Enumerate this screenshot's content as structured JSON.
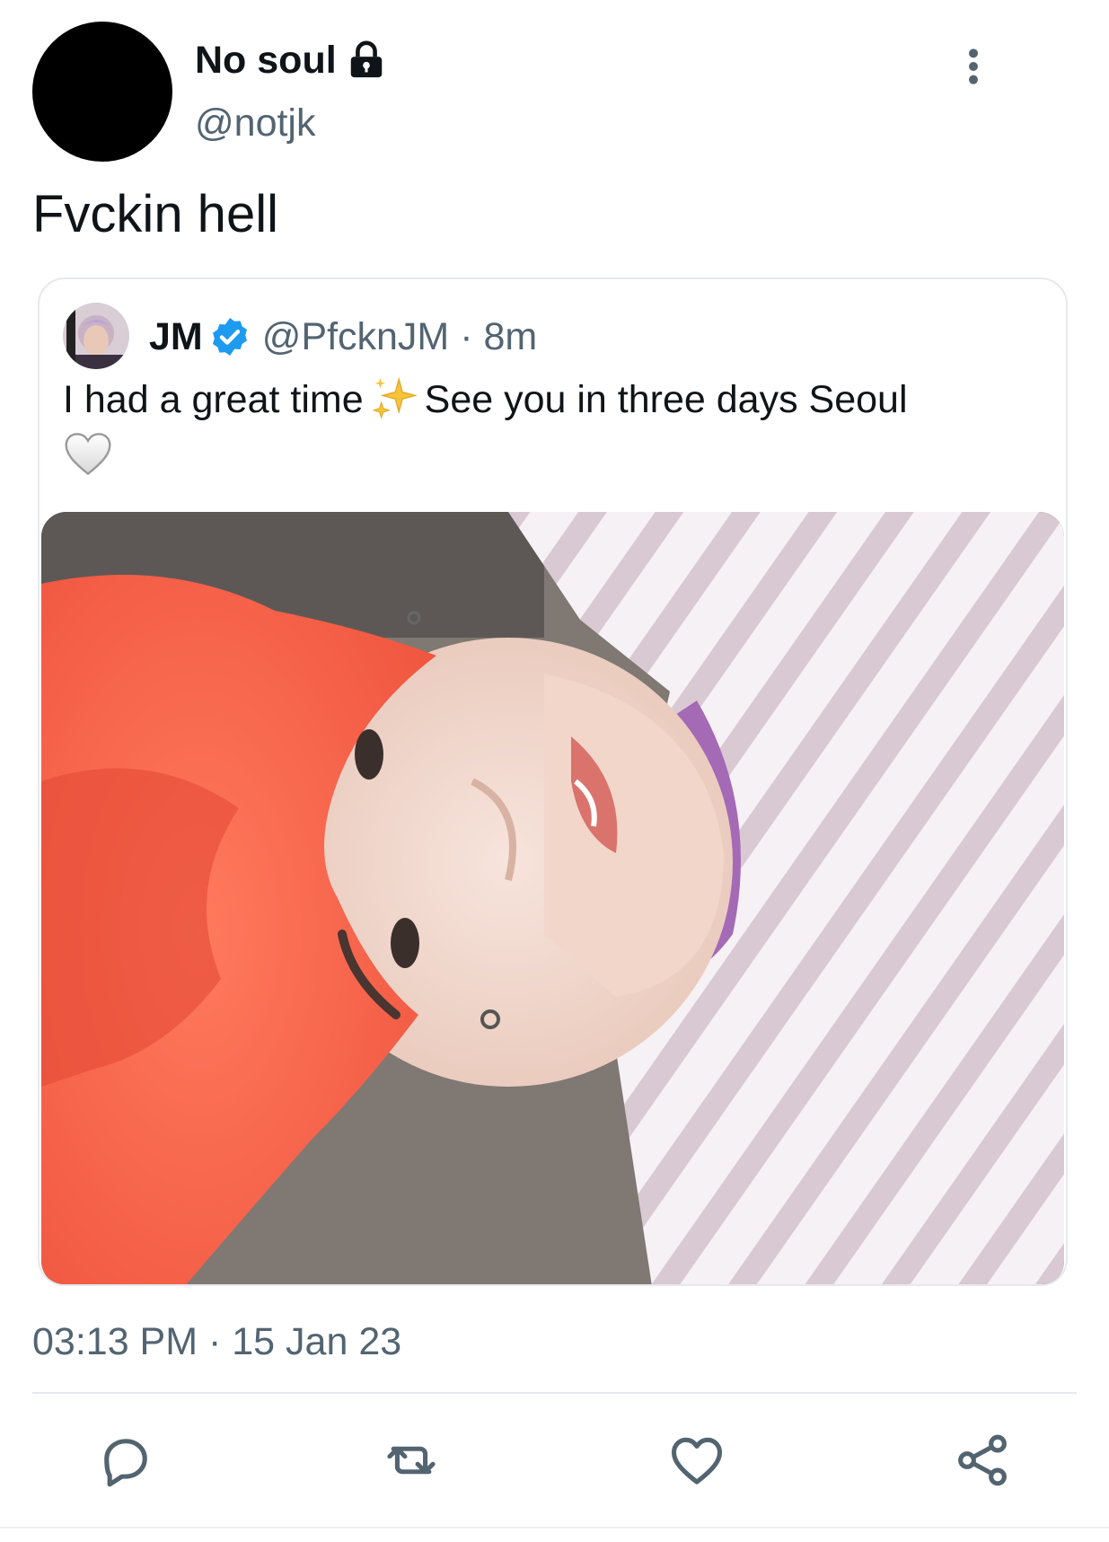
{
  "author": {
    "display_name": "No soul",
    "handle": "@notjk",
    "protected_icon": "lock-icon",
    "avatar_color": "#000000"
  },
  "tweet": {
    "text": "Fvckin hell",
    "timestamp": "03:13 PM · 15 Jan 23"
  },
  "quoted_tweet": {
    "display_name": "JM",
    "verified_icon": "verified-badge-icon",
    "handle_time": "@PfcknJM · 8m",
    "text_part1": "I had a great time",
    "emoji_1": "sparkles-icon",
    "text_part2": "See you in three days Seoul",
    "emoji_2": "white-heart-icon",
    "media": "photo of person with red hair lying down in striped shirt"
  },
  "actions": [
    "reply-icon",
    "retweet-icon",
    "like-icon",
    "share-icon"
  ],
  "colors": {
    "text_primary": "#0f1419",
    "text_secondary": "#536471",
    "divider": "#e6e9ec",
    "verified": "#1d9bf0",
    "action_icon": "#536471"
  }
}
